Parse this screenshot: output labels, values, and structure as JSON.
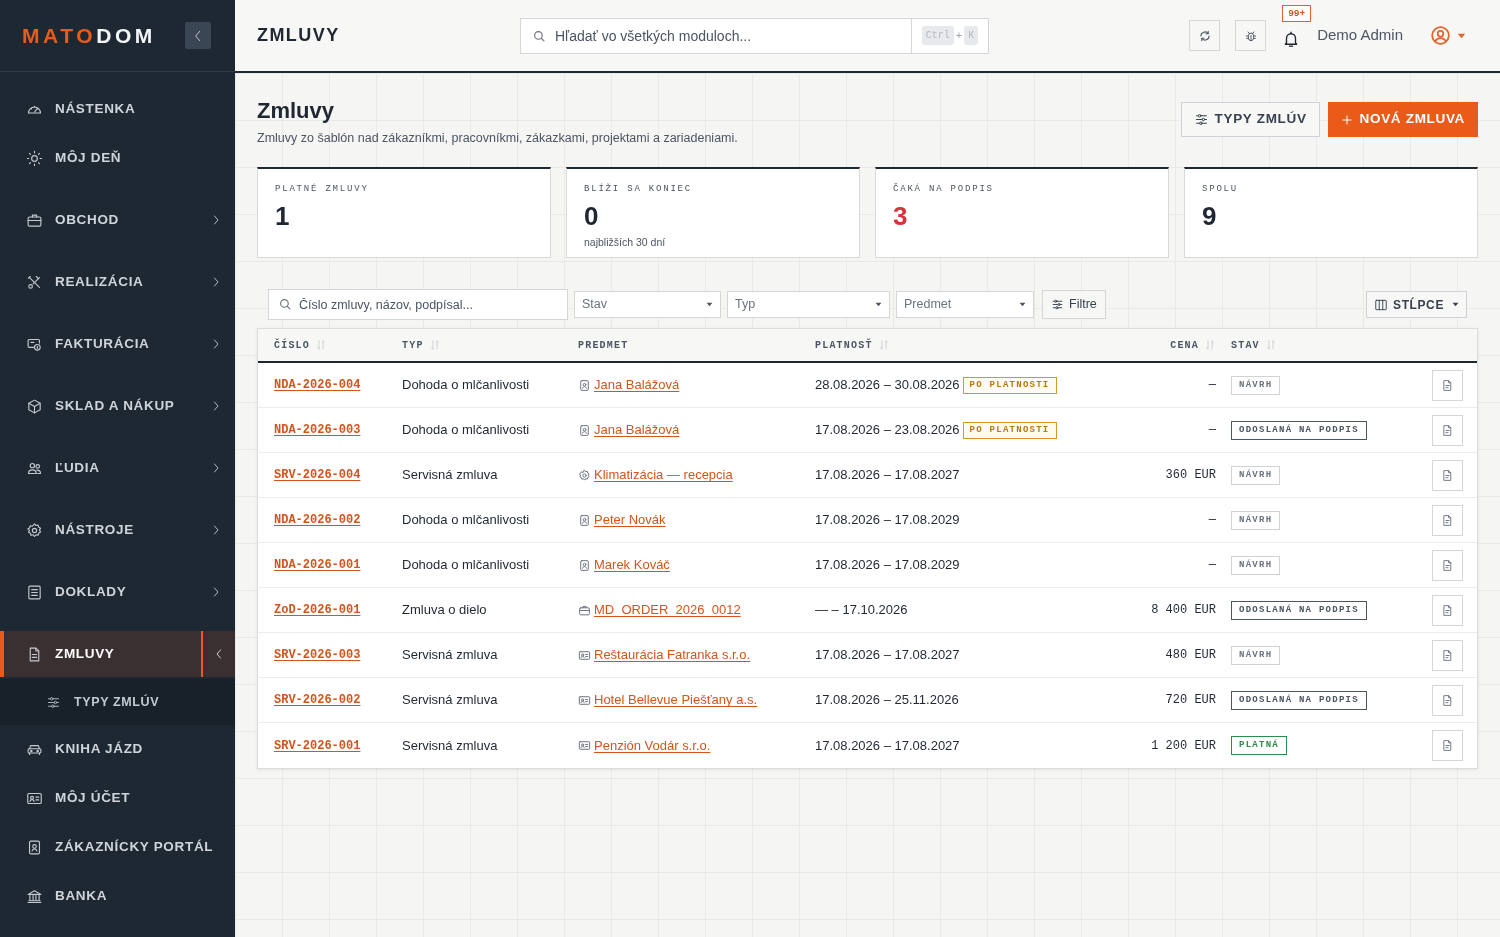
{
  "brand": {
    "logo_primary": "MATO",
    "logo_secondary": "DOM"
  },
  "sidebar": {
    "items": [
      {
        "label": "NÁSTENKA",
        "kind": "link",
        "selected": false
      },
      {
        "label": "MÔJ DEŇ",
        "kind": "link",
        "selected": false
      },
      {
        "label": "OBCHOD",
        "kind": "group",
        "selected": false,
        "expanded": false
      },
      {
        "label": "REALIZÁCIA",
        "kind": "group",
        "selected": false,
        "expanded": false
      },
      {
        "label": "FAKTURÁCIA",
        "kind": "group",
        "selected": false,
        "expanded": false
      },
      {
        "label": "SKLAD A NÁKUP",
        "kind": "group",
        "selected": false,
        "expanded": false
      },
      {
        "label": "ĽUDIA",
        "kind": "group",
        "selected": false,
        "expanded": false
      },
      {
        "label": "NÁSTROJE",
        "kind": "group",
        "selected": false,
        "expanded": false
      },
      {
        "label": "DOKLADY",
        "kind": "group",
        "selected": false,
        "expanded": false
      },
      {
        "label": "ZMLUVY",
        "kind": "group",
        "selected": true,
        "expanded": true,
        "children": [
          {
            "label": "TYPY ZMLÚV",
            "selected": false
          }
        ]
      },
      {
        "label": "KNIHA JÁZD",
        "kind": "link",
        "selected": false
      },
      {
        "label": "MÔJ ÚČET",
        "kind": "link",
        "selected": false
      },
      {
        "label": "ZÁKAZNÍCKY PORTÁL",
        "kind": "link",
        "selected": false
      },
      {
        "label": "BANKA",
        "kind": "link",
        "selected": false
      }
    ]
  },
  "topbar": {
    "title": "ZMLUVY",
    "search": {
      "placeholder": "Hľadať vo všetkých moduloch...",
      "shortcut_keys": [
        "Ctrl",
        "K"
      ],
      "shortcut_separator": "+"
    },
    "notification_count": "99+",
    "user_name": "Demo Admin"
  },
  "page": {
    "title": "Zmluvy",
    "subtitle": "Zmluvy zo šablón nad zákazníkmi, pracovníkmi, zákazkami, projektami a zariadeniami.",
    "actions": [
      {
        "label": "TYPY ZMLÚV",
        "kind": "secondary"
      },
      {
        "label": "NOVÁ ZMLUVA",
        "kind": "primary"
      }
    ]
  },
  "stats": [
    {
      "label": "PLATNÉ ZMLUVY",
      "value": "1",
      "alert": false
    },
    {
      "label": "BLÍŽI SA KONIEC",
      "value": "0",
      "note": "najbližších 30 dní",
      "alert": false
    },
    {
      "label": "ČAKÁ NA PODPIS",
      "value": "3",
      "alert": true
    },
    {
      "label": "SPOLU",
      "value": "9",
      "alert": false
    }
  ],
  "filters": {
    "search_placeholder": "Číslo zmluvy, názov, podpísal...",
    "selects": [
      {
        "placeholder": "Stav"
      },
      {
        "placeholder": "Typ"
      },
      {
        "placeholder": "Predmet"
      }
    ],
    "filter_button": "Filtre",
    "columns_button": "STĹPCE"
  },
  "table": {
    "columns": [
      {
        "label": "ČÍSLO",
        "sortable": true
      },
      {
        "label": "TYP",
        "sortable": true
      },
      {
        "label": "PREDMET",
        "sortable": false
      },
      {
        "label": "PLATNOSŤ",
        "sortable": true
      },
      {
        "label": "CENA",
        "sortable": true
      },
      {
        "label": "STAV",
        "sortable": true
      }
    ],
    "rows": [
      {
        "number": "NDA-2026-004",
        "type": "Dohoda o mlčanlivosti",
        "subject": {
          "kind": "person",
          "label": "Jana Balážová"
        },
        "validity": "28.08.2026 – 30.08.2026",
        "validity_badge": "PO PLATNOSTI",
        "price": "—",
        "status": {
          "kind": "draft",
          "label": "NÁVRH"
        }
      },
      {
        "number": "NDA-2026-003",
        "type": "Dohoda o mlčanlivosti",
        "subject": {
          "kind": "person",
          "label": "Jana Balážová"
        },
        "validity": "17.08.2026 – 23.08.2026",
        "validity_badge": "PO PLATNOSTI",
        "price": "—",
        "status": {
          "kind": "sent",
          "label": "ODOSLANÁ NA PODPIS"
        }
      },
      {
        "number": "SRV-2026-004",
        "type": "Servisná zmluva",
        "subject": {
          "kind": "equipment",
          "label": "Klimatizácia — recepcia"
        },
        "validity": "17.08.2026 – 17.08.2027",
        "price": "360 EUR",
        "status": {
          "kind": "draft",
          "label": "NÁVRH"
        }
      },
      {
        "number": "NDA-2026-002",
        "type": "Dohoda o mlčanlivosti",
        "subject": {
          "kind": "person",
          "label": "Peter Novák"
        },
        "validity": "17.08.2026 – 17.08.2029",
        "price": "—",
        "status": {
          "kind": "draft",
          "label": "NÁVRH"
        }
      },
      {
        "number": "NDA-2026-001",
        "type": "Dohoda o mlčanlivosti",
        "subject": {
          "kind": "person",
          "label": "Marek Kováč"
        },
        "validity": "17.08.2026 – 17.08.2029",
        "price": "—",
        "status": {
          "kind": "draft",
          "label": "NÁVRH"
        }
      },
      {
        "number": "ZoD-2026-001",
        "type": "Zmluva o dielo",
        "subject": {
          "kind": "order",
          "label": "MD_ORDER_2026_0012"
        },
        "validity": "— – 17.10.2026",
        "price": "8 400 EUR",
        "status": {
          "kind": "sent",
          "label": "ODOSLANÁ NA PODPIS"
        }
      },
      {
        "number": "SRV-2026-003",
        "type": "Servisná zmluva",
        "subject": {
          "kind": "company",
          "label": "Reštaurácia Fatranka s.r.o."
        },
        "validity": "17.08.2026 – 17.08.2027",
        "price": "480 EUR",
        "status": {
          "kind": "draft",
          "label": "NÁVRH"
        }
      },
      {
        "number": "SRV-2026-002",
        "type": "Servisná zmluva",
        "subject": {
          "kind": "company",
          "label": "Hotel Bellevue Piešťany a.s."
        },
        "validity": "17.08.2026 – 25.11.2026",
        "price": "720 EUR",
        "status": {
          "kind": "sent",
          "label": "ODOSLANÁ NA PODPIS"
        }
      },
      {
        "number": "SRV-2026-001",
        "type": "Servisná zmluva",
        "subject": {
          "kind": "company",
          "label": "Penzión Vodár s.r.o."
        },
        "validity": "17.08.2026 – 17.08.2027",
        "price": "1 200 EUR",
        "status": {
          "kind": "valid",
          "label": "PLATNÁ"
        }
      }
    ]
  }
}
